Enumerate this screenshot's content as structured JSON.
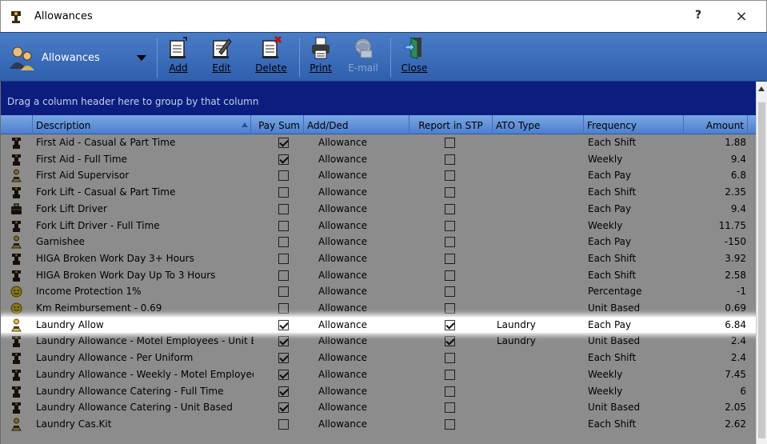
{
  "window": {
    "title": "Allowances",
    "help_glyph": "?",
    "close_glyph": "×"
  },
  "toolbar": {
    "view_label": "Allowances",
    "buttons": [
      {
        "id": "add",
        "label": "Add",
        "icon": "add-document-icon",
        "enabled": true
      },
      {
        "id": "edit",
        "label": "Edit",
        "icon": "edit-document-icon",
        "enabled": true
      },
      {
        "id": "delete",
        "label": "Delete",
        "icon": "delete-document-icon",
        "enabled": true
      },
      {
        "id": "print",
        "label": "Print",
        "icon": "printer-icon",
        "enabled": true
      },
      {
        "id": "email",
        "label": "E-mail",
        "icon": "email-globe-icon",
        "enabled": false
      },
      {
        "id": "close",
        "label": "Close",
        "icon": "exit-door-icon",
        "enabled": true
      }
    ]
  },
  "group_panel": {
    "hint": "Drag a column header here to group by that column"
  },
  "grid": {
    "columns": {
      "description": "Description",
      "pay_sum": "Pay Sum",
      "add_ded": "Add/Ded",
      "report_stp": "Report in STP",
      "ato_type": "ATO Type",
      "frequency": "Frequency",
      "amount": "Amount"
    },
    "sort_column": "description",
    "selected_row": 11,
    "rows": [
      {
        "icon": "dark-figure-icon",
        "description": "First Aid - Casual & Part Time",
        "pay_sum": true,
        "add_ded": "Allowance",
        "report_stp": false,
        "ato_type": "",
        "frequency": "Each Shift",
        "amount": "1.88"
      },
      {
        "icon": "dark-figure-icon",
        "description": "First Aid - Full Time",
        "pay_sum": true,
        "add_ded": "Allowance",
        "report_stp": false,
        "ato_type": "",
        "frequency": "Weekly",
        "amount": "9.4"
      },
      {
        "icon": "gold-figure-icon",
        "description": "First Aid Supervisor",
        "pay_sum": false,
        "add_ded": "Allowance",
        "report_stp": false,
        "ato_type": "",
        "frequency": "Each Pay",
        "amount": "6.8"
      },
      {
        "icon": "dark-figure-icon",
        "description": "Fork Lift - Casual & Part Time",
        "pay_sum": false,
        "add_ded": "Allowance",
        "report_stp": false,
        "ato_type": "",
        "frequency": "Each Shift",
        "amount": "2.35"
      },
      {
        "icon": "briefcase-icon",
        "description": "Fork Lift Driver",
        "pay_sum": false,
        "add_ded": "Allowance",
        "report_stp": false,
        "ato_type": "",
        "frequency": "Each Pay",
        "amount": "9.4"
      },
      {
        "icon": "dark-figure-icon",
        "description": "Fork Lift Driver - Full Time",
        "pay_sum": false,
        "add_ded": "Allowance",
        "report_stp": false,
        "ato_type": "",
        "frequency": "Weekly",
        "amount": "11.75"
      },
      {
        "icon": "gold-figure-icon",
        "description": "Garnishee",
        "pay_sum": false,
        "add_ded": "Allowance",
        "report_stp": false,
        "ato_type": "",
        "frequency": "Each Pay",
        "amount": "-150"
      },
      {
        "icon": "dark-figure-icon",
        "description": "HIGA Broken Work Day 3+ Hours",
        "pay_sum": false,
        "add_ded": "Allowance",
        "report_stp": false,
        "ato_type": "",
        "frequency": "Each Shift",
        "amount": "3.92"
      },
      {
        "icon": "dark-figure-icon",
        "description": "HIGA Broken Work Day Up To 3 Hours",
        "pay_sum": false,
        "add_ded": "Allowance",
        "report_stp": false,
        "ato_type": "",
        "frequency": "Each Shift",
        "amount": "2.58"
      },
      {
        "icon": "smiley-icon",
        "description": "Income Protection 1%",
        "pay_sum": false,
        "add_ded": "Allowance",
        "report_stp": false,
        "ato_type": "",
        "frequency": "Percentage",
        "amount": "-1"
      },
      {
        "icon": "smiley-icon",
        "description": "Km Reimbursement - 0.69",
        "pay_sum": false,
        "add_ded": "Allowance",
        "report_stp": false,
        "ato_type": "",
        "frequency": "Unit Based",
        "amount": "0.69"
      },
      {
        "icon": "gold-figure-icon",
        "description": "Laundry Allow",
        "pay_sum": true,
        "add_ded": "Allowance",
        "report_stp": true,
        "ato_type": "Laundry",
        "frequency": "Each Pay",
        "amount": "6.84"
      },
      {
        "icon": "dark-figure-icon",
        "description": "Laundry Allowance - Motel Employees - Unit Ba",
        "pay_sum": true,
        "add_ded": "Allowance",
        "report_stp": true,
        "ato_type": "Laundry",
        "frequency": "Unit Based",
        "amount": "2.4"
      },
      {
        "icon": "dark-figure-icon",
        "description": "Laundry Allowance - Per Uniform",
        "pay_sum": true,
        "add_ded": "Allowance",
        "report_stp": false,
        "ato_type": "",
        "frequency": "Each Shift",
        "amount": "2.4"
      },
      {
        "icon": "dark-figure-icon",
        "description": "Laundry Allowance - Weekly - Motel Employees",
        "pay_sum": true,
        "add_ded": "Allowance",
        "report_stp": false,
        "ato_type": "",
        "frequency": "Weekly",
        "amount": "7.45"
      },
      {
        "icon": "dark-figure-icon",
        "description": "Laundry Allowance Catering - Full Time",
        "pay_sum": true,
        "add_ded": "Allowance",
        "report_stp": false,
        "ato_type": "",
        "frequency": "Weekly",
        "amount": "6"
      },
      {
        "icon": "dark-figure-icon",
        "description": "Laundry Allowance Catering - Unit Based",
        "pay_sum": true,
        "add_ded": "Allowance",
        "report_stp": false,
        "ato_type": "",
        "frequency": "Unit Based",
        "amount": "2.05"
      },
      {
        "icon": "gold-figure-icon",
        "description": "Laundry Cas.Kit",
        "pay_sum": false,
        "add_ded": "Allowance",
        "report_stp": false,
        "ato_type": "",
        "frequency": "Each Shift",
        "amount": "2.62"
      }
    ]
  },
  "colors": {
    "toolbar_top": "#4a7dc6",
    "toolbar_bottom": "#2f5fae",
    "group_panel": "#0b1e80",
    "header": "#6b9be0"
  }
}
